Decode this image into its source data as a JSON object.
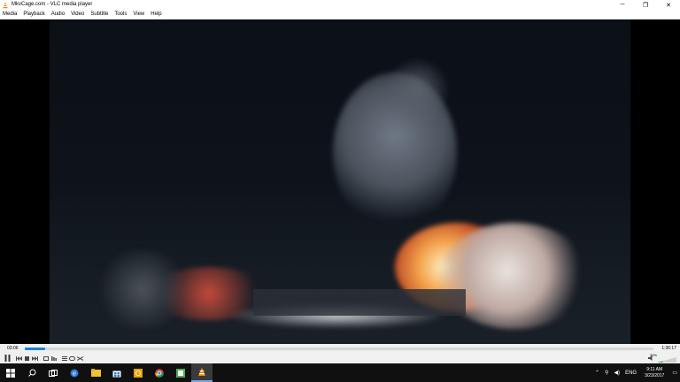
{
  "window": {
    "title": "MkvCage.com - VLC media player",
    "controls": {
      "minimize": "─",
      "maximize": "❐",
      "close": "✕"
    }
  },
  "menu": {
    "items": [
      "Media",
      "Playback",
      "Audio",
      "Video",
      "Subtitle",
      "Tools",
      "View",
      "Help"
    ]
  },
  "player": {
    "elapsed": "03:06",
    "total": "1:36:17",
    "progress_fraction": 0.032,
    "volume_label": "30%",
    "volume_fraction": 0.3,
    "accent": "#1f7fd6"
  },
  "controls": {
    "play_pause_icon": "pause-icon",
    "buttons": [
      "previous-icon",
      "stop-icon",
      "next-icon",
      "fullscreen-icon",
      "extended-settings-icon",
      "playlist-icon",
      "loop-icon",
      "random-icon"
    ]
  },
  "taskbar": {
    "icons": [
      "windows-start-icon",
      "search-icon",
      "task-view-icon",
      "edge-icon",
      "file-explorer-icon",
      "store-icon",
      "outlook-icon",
      "chrome-icon",
      "app-icon",
      "vlc-icon"
    ],
    "tray": {
      "language": "ENG",
      "time": "9:11 AM",
      "date": "3/23/2017"
    }
  }
}
